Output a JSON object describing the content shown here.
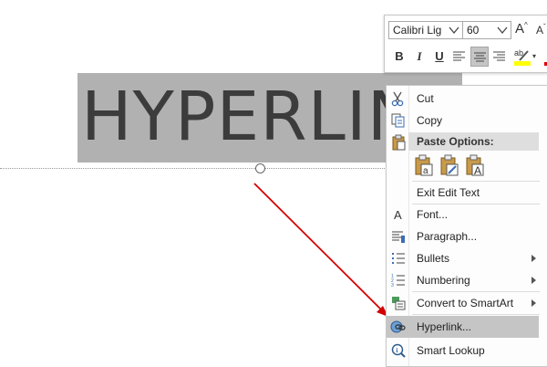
{
  "slide": {
    "text": "HYPERLINK",
    "selection_color": "#b1b1b1",
    "arrow_color": "#d40000"
  },
  "mini_toolbar": {
    "font_name": "Calibri Lig",
    "font_size": "60",
    "grow_font_label": "A",
    "shrink_font_label": "A",
    "bold_label": "B",
    "italic_label": "I",
    "underline_label": "U",
    "highlight_label": "ab",
    "active_alignment": "center"
  },
  "context_menu": {
    "items": [
      {
        "label": "Cut",
        "icon": "scissors-icon"
      },
      {
        "label": "Copy",
        "icon": "copy-icon"
      },
      {
        "label": "Paste Options:",
        "icon": "clipboard-icon"
      },
      {
        "label": "Exit Edit Text",
        "icon": ""
      },
      {
        "label": "Font...",
        "icon": "font-icon"
      },
      {
        "label": "Paragraph...",
        "icon": "paragraph-icon"
      },
      {
        "label": "Bullets",
        "icon": "bullets-icon",
        "submenu": true
      },
      {
        "label": "Numbering",
        "icon": "numbering-icon",
        "submenu": true
      },
      {
        "label": "Convert to SmartArt",
        "icon": "smartart-icon",
        "submenu": true
      },
      {
        "label": "Hyperlink...",
        "icon": "hyperlink-icon",
        "highlighted": true
      },
      {
        "label": "Smart Lookup",
        "icon": "smart-lookup-icon"
      }
    ],
    "paste_option_icons": [
      "paste-keep-source-formatting-icon",
      "paste-use-destination-theme-icon",
      "paste-keep-text-only-icon"
    ],
    "highlight_color": "#c5c5c5"
  }
}
